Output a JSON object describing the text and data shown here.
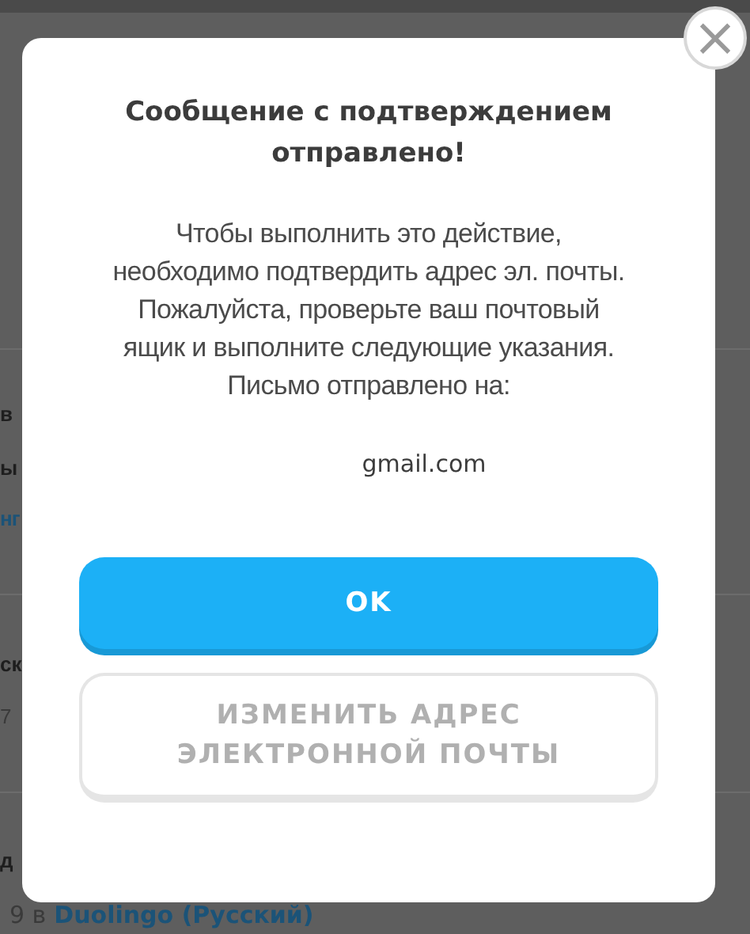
{
  "background": {
    "fragments": [
      {
        "kind": "heading",
        "text": "в"
      },
      {
        "kind": "heading",
        "text": "ы"
      },
      {
        "kind": "link",
        "text": "нг"
      },
      {
        "kind": "heading",
        "text": "ск"
      },
      {
        "kind": "meta",
        "text": "7"
      },
      {
        "kind": "heading",
        "text": "д"
      }
    ],
    "footer": {
      "prefix": "9 в",
      "link": "Duolingo (Русский)"
    }
  },
  "dialog": {
    "close": "×",
    "title": "Сообщение с подтверждением отправлено!",
    "body": [
      "Чтобы выполнить это действие,",
      "необходимо подтвердить адрес эл. почты.",
      "Пожалуйста, проверьте ваш почтовый",
      "ящик и выполните следующие указания.",
      "Письмо отправлено на:"
    ],
    "email": "gmail.com",
    "buttons": [
      {
        "kind": "primary",
        "label": "OK"
      },
      {
        "kind": "secondary",
        "label": "ИЗМЕНИТЬ АДРЕС ЭЛЕКТРОННОЙ ПОЧТЫ"
      }
    ]
  }
}
